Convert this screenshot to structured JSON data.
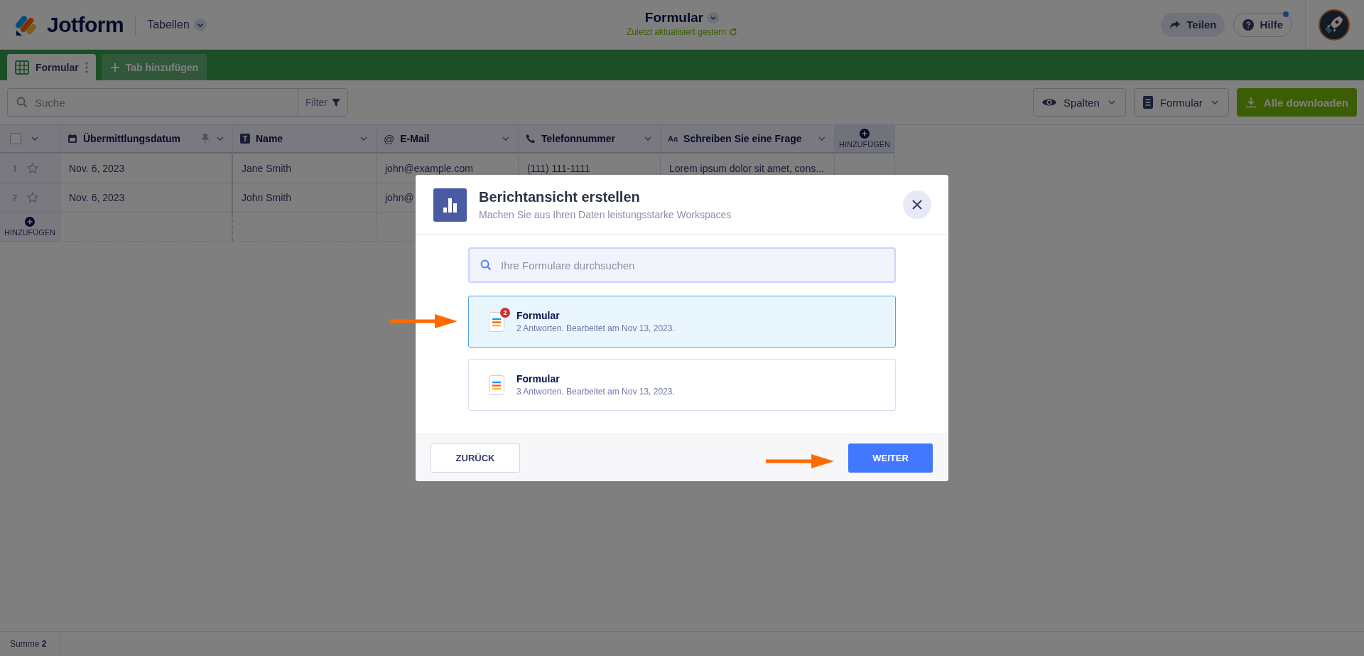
{
  "header": {
    "logo": "Jotform",
    "section": "Tabellen",
    "title": "Formular",
    "subtitle": "Zuletzt aktualisiert gestern",
    "share_button": "Teilen",
    "help_button": "Hilfe",
    "help_notification": true
  },
  "tabs": [
    {
      "label": "Formular",
      "selected": true
    }
  ],
  "add_tab": "Tab hinzufügen",
  "toolbar": {
    "search_placeholder": "Suche",
    "filter_button": "Filter",
    "columns_button": "Spalten",
    "form_button": "Formular",
    "download_button": "Alle downloaden"
  },
  "table": {
    "columns": [
      {
        "label": "Übermittlungsdatum",
        "kind": "date",
        "pinned": true
      },
      {
        "label": "Name",
        "kind": "shorttext",
        "icon": "T",
        "pinned": false
      },
      {
        "label": "E-Mail",
        "kind": "email",
        "icon": "@",
        "pinned": false
      },
      {
        "label": "Telefonnummer",
        "kind": "phone",
        "pinned": false
      },
      {
        "label": "Schreiben Sie eine Frage",
        "kind": "longtext",
        "icon": "Aa",
        "pinned": false
      }
    ],
    "select_all": {
      "checked": false
    },
    "add_column": "HINZUFÜGEN",
    "rows": [
      {
        "number": "1",
        "starred": false,
        "cells": [
          "Nov. 6, 2023",
          "Jane Smith",
          "john@example.com",
          "(111) 111-1111",
          "Lorem ipsum dolor sit amet, cons..."
        ]
      },
      {
        "number": "2",
        "starred": false,
        "cells": [
          "Nov. 6, 2023",
          "John Smith",
          "john@"
        ]
      }
    ],
    "add_row": "HINZUFÜGEN"
  },
  "footer": {
    "total": "Summe **2**"
  },
  "dialog": {
    "title": "Berichtansicht erstellen",
    "subtitle": "Machen Sie aus Ihren Daten leistungsstarke Workspaces",
    "search_placeholder": "Ihre Formulare durchsuchen",
    "forms": [
      {
        "name": "Formular",
        "details": "2 Antworten. Bearbeitet am Nov 13, 2023.",
        "badge": "2",
        "selected": true
      },
      {
        "name": "Formular",
        "details": "3 Antworten. Bearbeitet am Nov 13, 2023.",
        "selected": false
      }
    ],
    "back_button": "ZURÜCK",
    "next_button": "WEITER"
  }
}
